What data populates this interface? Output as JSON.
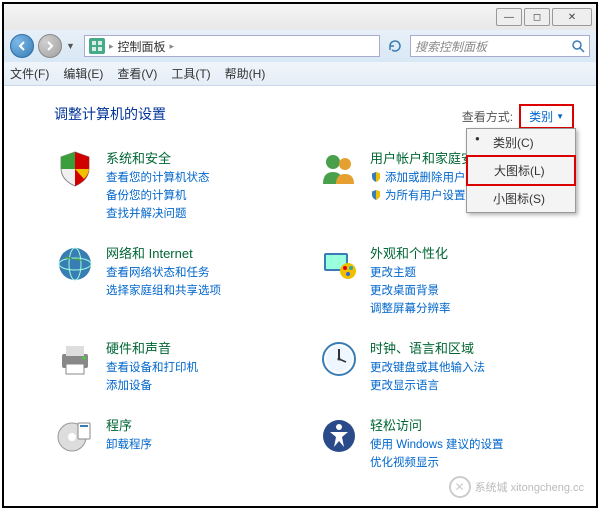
{
  "titlebar": {
    "min": "—",
    "max": "◻",
    "close": "✕"
  },
  "address": {
    "breadcrumb_label": "控制面板",
    "search_placeholder": "搜索控制面板"
  },
  "menubar": {
    "file": "文件(F)",
    "edit": "编辑(E)",
    "view": "查看(V)",
    "tools": "工具(T)",
    "help": "帮助(H)"
  },
  "heading": "调整计算机的设置",
  "view_by": {
    "label": "查看方式:",
    "current": "类别",
    "menu": {
      "category": "类别(C)",
      "large": "大图标(L)",
      "small": "小图标(S)"
    }
  },
  "categories": {
    "system": {
      "title": "系统和安全",
      "links": [
        "查看您的计算机状态",
        "备份您的计算机",
        "查找并解决问题"
      ]
    },
    "user": {
      "title": "用户帐户和家庭安全",
      "links": [
        "添加或删除用户帐户",
        "为所有用户设置家长控制"
      ]
    },
    "network": {
      "title": "网络和 Internet",
      "links": [
        "查看网络状态和任务",
        "选择家庭组和共享选项"
      ]
    },
    "appearance": {
      "title": "外观和个性化",
      "links": [
        "更改主题",
        "更改桌面背景",
        "调整屏幕分辨率"
      ]
    },
    "hardware": {
      "title": "硬件和声音",
      "links": [
        "查看设备和打印机",
        "添加设备"
      ]
    },
    "clock": {
      "title": "时钟、语言和区域",
      "links": [
        "更改键盘或其他输入法",
        "更改显示语言"
      ]
    },
    "programs": {
      "title": "程序",
      "links": [
        "卸载程序"
      ]
    },
    "ease": {
      "title": "轻松访问",
      "links": [
        "使用 Windows 建议的设置",
        "优化视频显示"
      ]
    }
  },
  "watermark": "系统城 xitongcheng.cc"
}
